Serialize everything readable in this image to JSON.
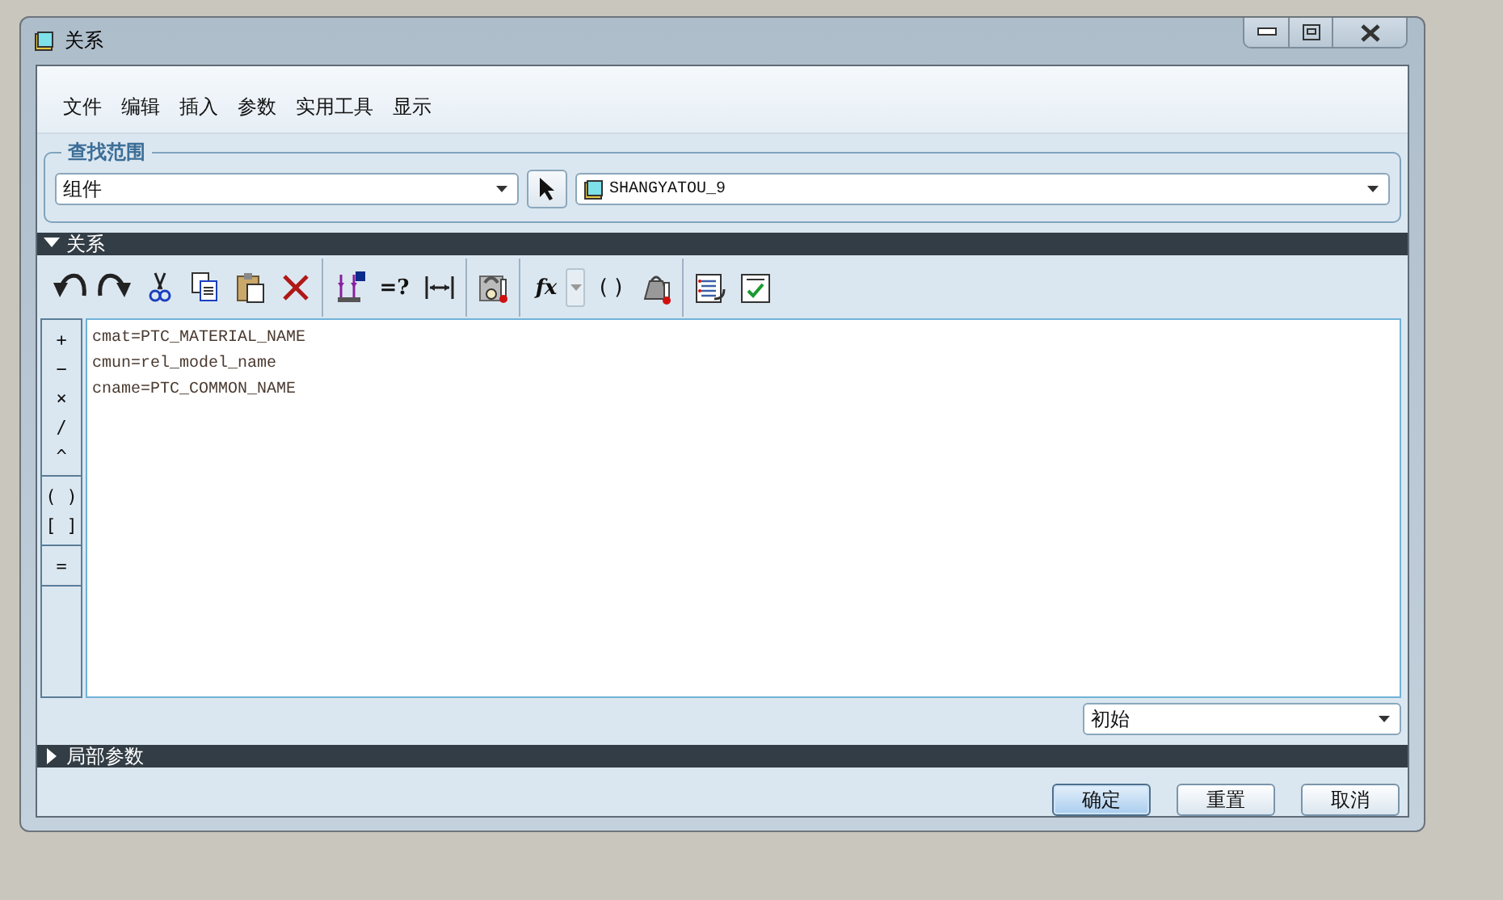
{
  "window": {
    "title": "关系"
  },
  "menu": [
    "文件",
    "编辑",
    "插入",
    "参数",
    "实用工具",
    "显示"
  ],
  "scope": {
    "legend": "查找范围",
    "type_value": "组件",
    "model_value": "SHANGYATOU_9"
  },
  "relations_section": {
    "title": "关系",
    "expanded": true
  },
  "toolbar": {
    "evaluate_label": "=?",
    "function_label": "fx",
    "brackets_label": "( )"
  },
  "operators": [
    [
      "+",
      "−",
      "×",
      "/",
      "^"
    ],
    [
      "( )",
      "[ ]"
    ],
    [
      "="
    ]
  ],
  "relations": [
    "cmat=PTC_MATERIAL_NAME",
    "cmun=rel_model_name",
    "cname=PTC_COMMON_NAME"
  ],
  "filter": {
    "value": "初始"
  },
  "local_params_section": {
    "title": "局部参数",
    "expanded": false
  },
  "buttons": [
    {
      "label": "确定",
      "default": true
    },
    {
      "label": "重置",
      "default": false
    },
    {
      "label": "取消",
      "default": false
    }
  ]
}
